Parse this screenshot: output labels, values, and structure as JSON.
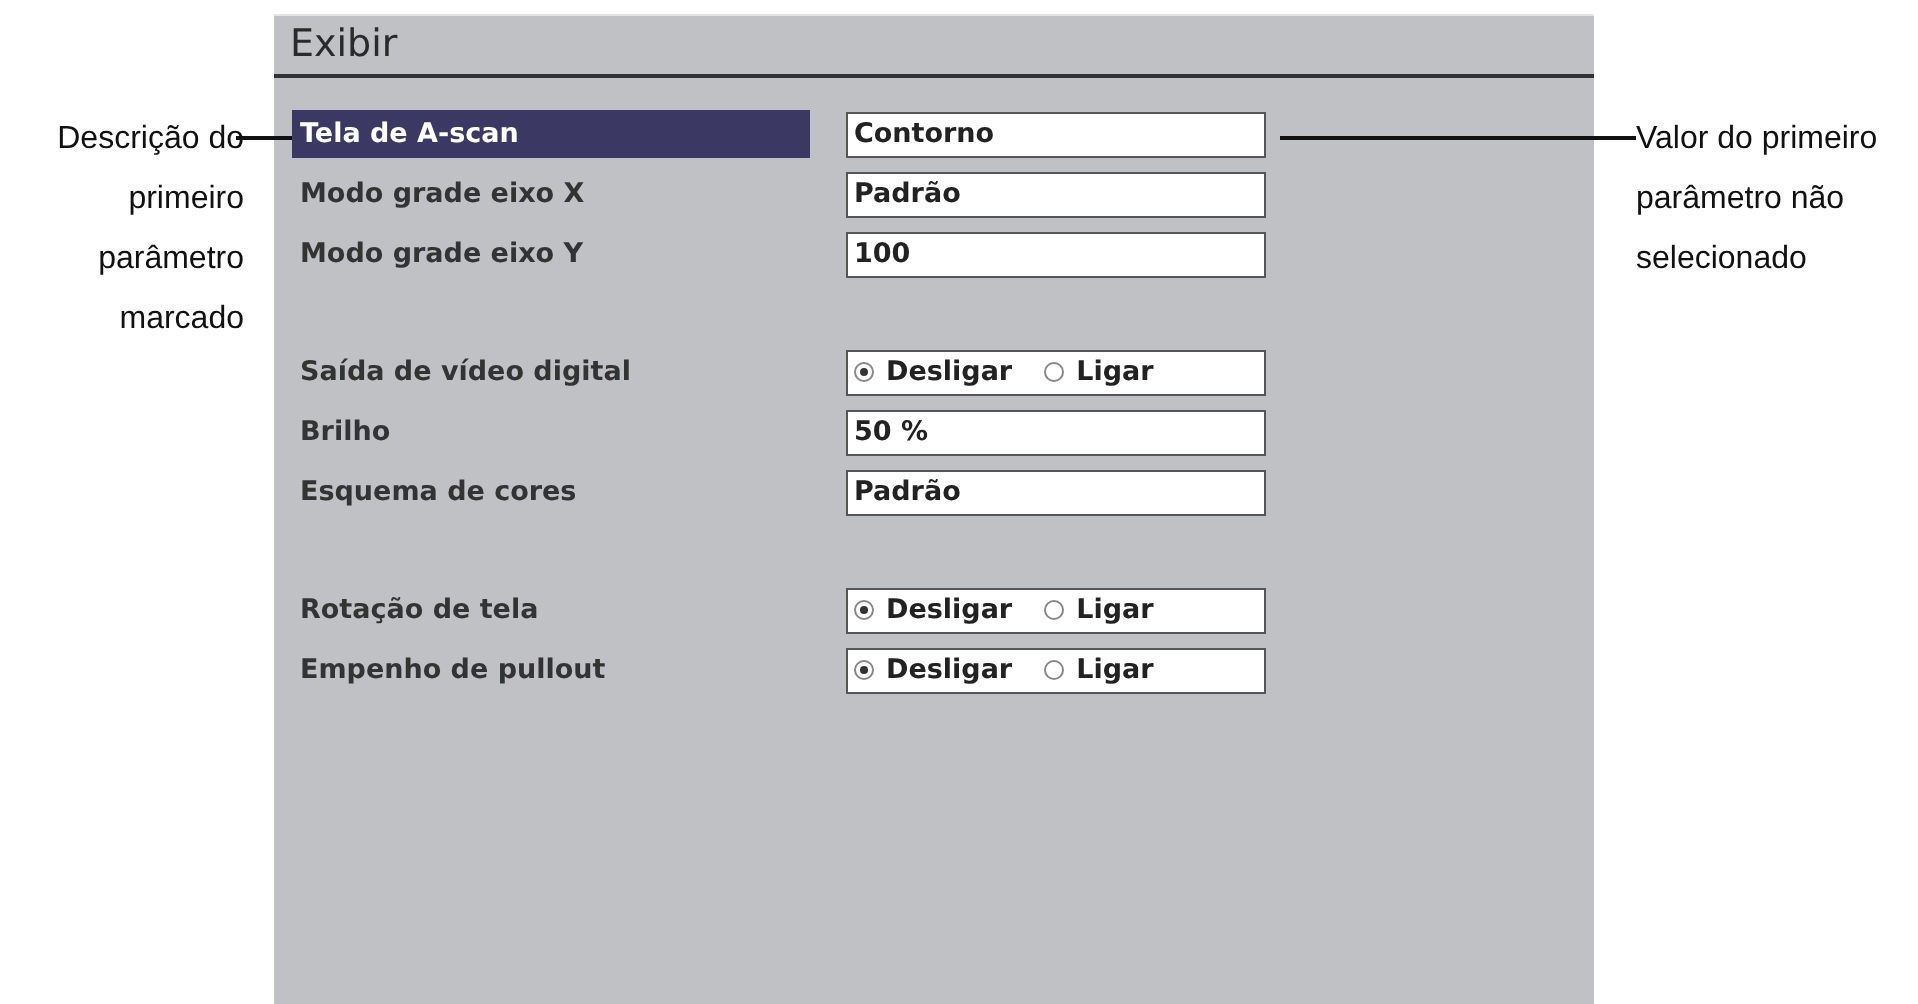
{
  "callouts": {
    "left": "Descrição do primeiro parâmetro marcado",
    "right": "Valor do primeiro parâmetro não selecionado"
  },
  "window": {
    "title": "Exibir"
  },
  "groups": [
    {
      "rows": [
        {
          "label": "Tela de A-scan",
          "selected": true,
          "kind": "text",
          "value": "Contorno"
        },
        {
          "label": "Modo grade eixo X",
          "selected": false,
          "kind": "text",
          "value": "Padrão"
        },
        {
          "label": "Modo grade eixo Y",
          "selected": false,
          "kind": "text",
          "value": "100"
        }
      ]
    },
    {
      "rows": [
        {
          "label": "Saída de vídeo digital",
          "selected": false,
          "kind": "radio",
          "options": [
            {
              "label": "Desligar",
              "selected": true
            },
            {
              "label": "Ligar",
              "selected": false
            }
          ]
        },
        {
          "label": "Brilho",
          "selected": false,
          "kind": "text",
          "value": "50 %"
        },
        {
          "label": "Esquema de cores",
          "selected": false,
          "kind": "text",
          "value": "Padrão"
        }
      ]
    },
    {
      "rows": [
        {
          "label": "Rotação de tela",
          "selected": false,
          "kind": "radio",
          "options": [
            {
              "label": "Desligar",
              "selected": true
            },
            {
              "label": "Ligar",
              "selected": false
            }
          ]
        },
        {
          "label": "Empenho de pullout",
          "selected": false,
          "kind": "radio",
          "options": [
            {
              "label": "Desligar",
              "selected": true
            },
            {
              "label": "Ligar",
              "selected": false
            }
          ]
        }
      ]
    }
  ]
}
